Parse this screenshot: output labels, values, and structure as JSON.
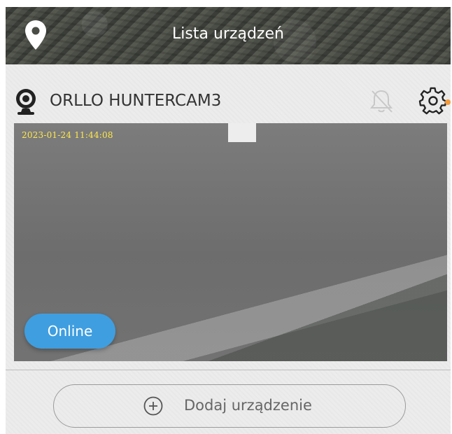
{
  "header": {
    "title": "Lista urządzeń",
    "left_icon": "location-pin-icon"
  },
  "device": {
    "name": "ORLLO HUNTERCAM3",
    "icon": "webcam-icon",
    "notification_icon": "bell-off-icon",
    "settings_icon": "gear-icon",
    "timestamp": "2023-01-24  11:44:08",
    "status": "Online"
  },
  "footer": {
    "add_label": "Dodaj urządzenie",
    "add_icon": "plus-circle-icon"
  },
  "colors": {
    "status_badge": "#3f9ee0",
    "timestamp_text": "#ffe84a",
    "settings_dot": "#f39a3a"
  }
}
